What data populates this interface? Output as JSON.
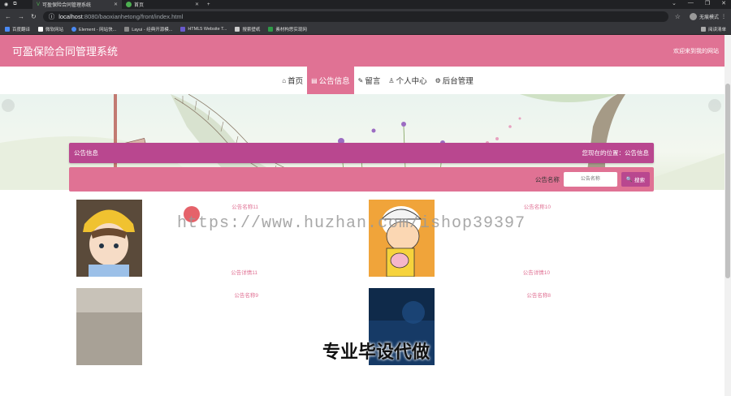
{
  "browser": {
    "tabs": [
      {
        "label": "可盈保险合同管理系统",
        "active": true
      },
      {
        "label": "首页",
        "active": false
      }
    ],
    "new_tab": "+",
    "url_host": "localhost",
    "url_path": ":8080/baoxianhetong/front/index.html",
    "profile_label": "无痕模式",
    "bookmarks": [
      "百度翻译",
      "微软网站",
      "Element - 网站快...",
      "Layui - 经典开源模...",
      "HTML5 Website T...",
      "搜索壁纸",
      "素材构思实现网"
    ],
    "bookmarks_right": "阅读清单"
  },
  "header": {
    "title": "可盈保险合同管理系统",
    "welcome": "欢迎来到我的网站"
  },
  "nav": [
    {
      "icon": "⌂",
      "label": "首页",
      "active": false
    },
    {
      "icon": "▤",
      "label": "公告信息",
      "active": true
    },
    {
      "icon": "✎",
      "label": "留言",
      "active": false
    },
    {
      "icon": "♙",
      "label": "个人中心",
      "active": false
    },
    {
      "icon": "⚙",
      "label": "后台管理",
      "active": false
    }
  ],
  "breadcrumb": {
    "section": "公告信息",
    "position_label": "您现在的位置：公告信息"
  },
  "search": {
    "label": "公告名称",
    "placeholder": "公告名称",
    "button": "搜索"
  },
  "cards": [
    {
      "name": "公告名称11",
      "detail": "公告详情11"
    },
    {
      "name": "公告名称10",
      "detail": "公告详情10"
    },
    {
      "name": "公告名称9",
      "detail": ""
    },
    {
      "name": "公告名称8",
      "detail": ""
    }
  ],
  "overlay": {
    "watermark": "https://www.huzhan.com/ishop39397",
    "promo": "专业毕设代做"
  },
  "colors": {
    "primary": "#e07294",
    "secondary": "#b9478f"
  }
}
